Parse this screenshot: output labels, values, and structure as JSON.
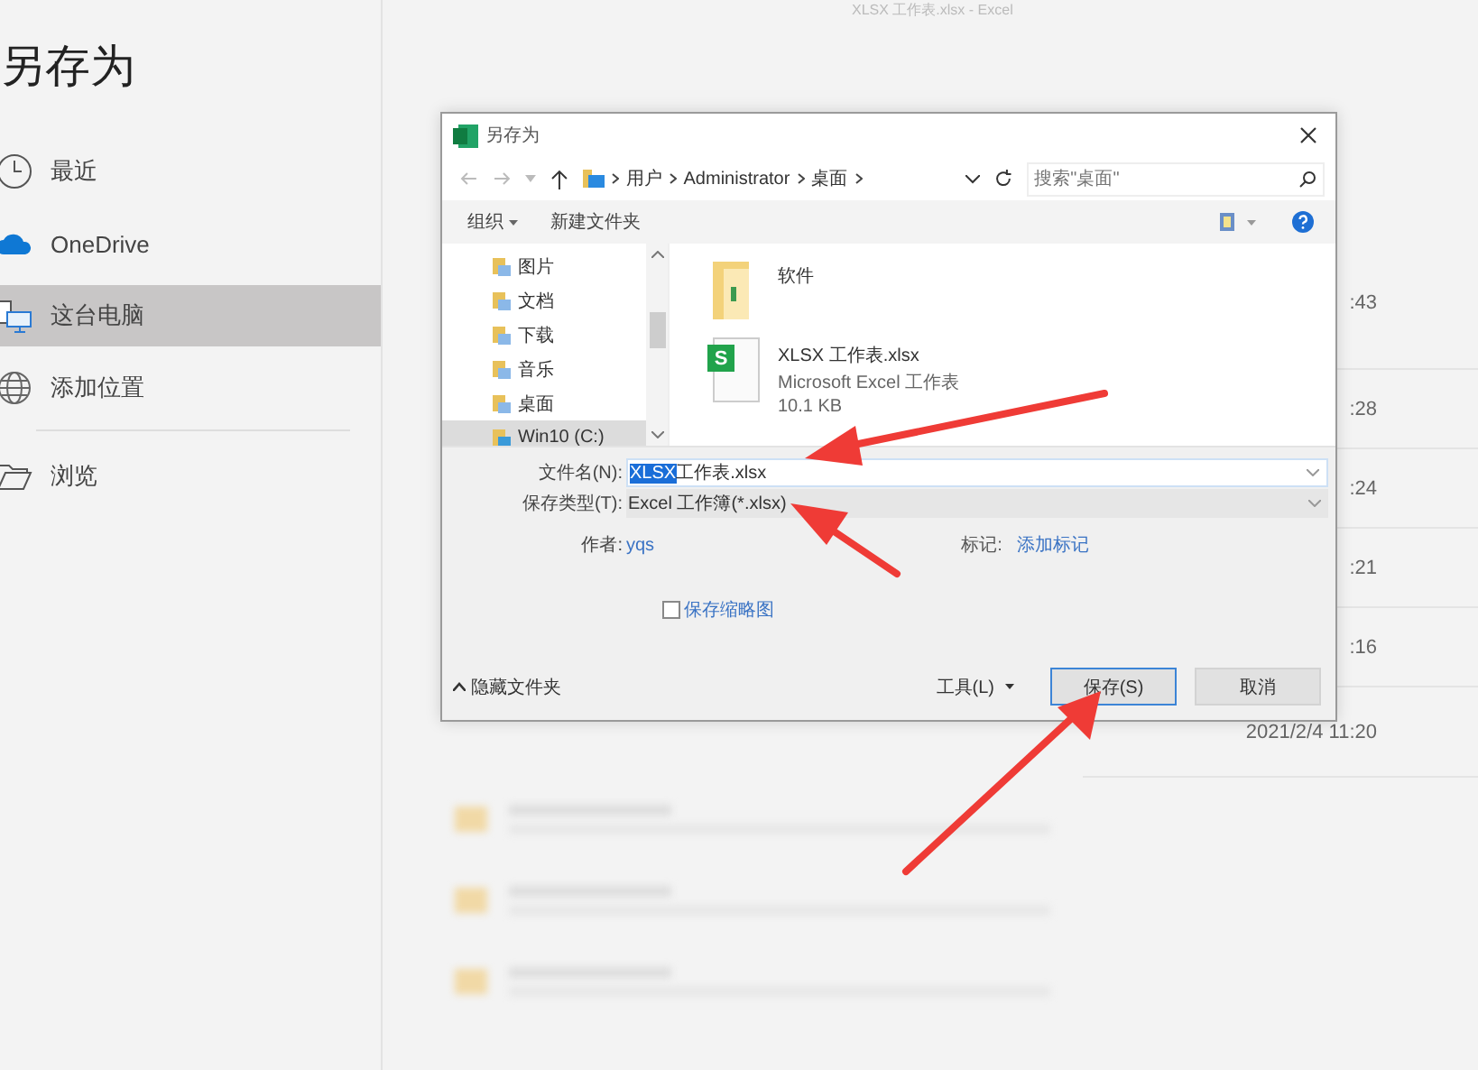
{
  "app_title": "XLSX 工作表.xlsx - Excel",
  "page_title": "另存为",
  "nav": [
    {
      "kind": "clock",
      "label": "最近",
      "selected": false
    },
    {
      "kind": "cloud",
      "label": "OneDrive",
      "selected": false
    },
    {
      "kind": "computer",
      "label": "这台电脑",
      "selected": true
    },
    {
      "kind": "globe",
      "label": "添加位置",
      "selected": false
    },
    {
      "kind": "folder",
      "label": "浏览",
      "selected": false
    }
  ],
  "recent_rows": [
    {
      "time": ":43"
    },
    {
      "time": ":28"
    },
    {
      "time": ":24"
    },
    {
      "time": ":21"
    },
    {
      "time": ":16"
    },
    {
      "time": "2021/2/4 11:20"
    }
  ],
  "dialog": {
    "title": "另存为",
    "breadcrumb": [
      "用户",
      "Administrator",
      "桌面"
    ],
    "search": {
      "placeholder": "搜索\"桌面\""
    },
    "toolbar": [
      {
        "label": "组织",
        "dropdown": true
      },
      {
        "label": "新建文件夹",
        "dropdown": false
      }
    ],
    "nav_pane": [
      {
        "label": "图片",
        "selected": false
      },
      {
        "label": "文档",
        "selected": false
      },
      {
        "label": "下载",
        "selected": false
      },
      {
        "label": "音乐",
        "selected": false
      },
      {
        "label": "桌面",
        "selected": false
      },
      {
        "label": "Win10 (C:)",
        "selected": true
      }
    ],
    "files": [
      {
        "kind": "folder",
        "name": "软件"
      },
      {
        "kind": "sheet",
        "name": "XLSX 工作表.xlsx",
        "type": "Microsoft Excel 工作表",
        "size": "10.1 KB",
        "icon_letter": "S"
      }
    ],
    "form": {
      "filename_label": "文件名(N):",
      "filename_selected": "XLSX",
      "filename_rest": " 工作表.xlsx",
      "type_label": "保存类型(T):",
      "type_value": "Excel 工作簿(*.xlsx)",
      "author_label": "作者:",
      "author": "yqs",
      "tags_label": "标记:",
      "tags": "添加标记",
      "thumbnail": {
        "label": "保存缩略图",
        "checked": false
      }
    },
    "footer": {
      "hide_folders": "隐藏文件夹",
      "tools": "工具(L)",
      "save": "保存(S)",
      "cancel": "取消"
    }
  }
}
